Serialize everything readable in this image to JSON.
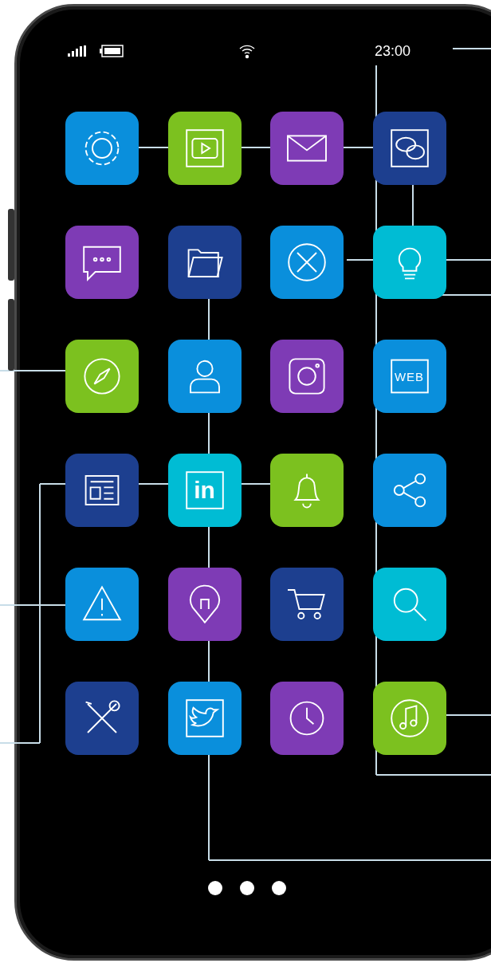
{
  "status_bar": {
    "time": "23:00"
  },
  "apps": [
    {
      "kind": "settings",
      "color": "#0a8fdc"
    },
    {
      "kind": "video",
      "color": "#7cc11f"
    },
    {
      "kind": "mail",
      "color": "#7e3bb5"
    },
    {
      "kind": "chat",
      "color": "#1d3f8f"
    },
    {
      "kind": "message",
      "color": "#7e3bb5"
    },
    {
      "kind": "folder",
      "color": "#1d3f8f"
    },
    {
      "kind": "repair",
      "color": "#0a8fdc"
    },
    {
      "kind": "bulb",
      "color": "#00bcd4"
    },
    {
      "kind": "compass",
      "color": "#7cc11f"
    },
    {
      "kind": "person",
      "color": "#0a8fdc"
    },
    {
      "kind": "camera",
      "color": "#7e3bb5"
    },
    {
      "kind": "web",
      "color": "#0a8fdc",
      "label": "WEB"
    },
    {
      "kind": "news",
      "color": "#1d3f8f"
    },
    {
      "kind": "linked",
      "color": "#00bcd4",
      "label": "in"
    },
    {
      "kind": "bell",
      "color": "#7cc11f"
    },
    {
      "kind": "share",
      "color": "#0a8fdc"
    },
    {
      "kind": "warning",
      "color": "#0a8fdc"
    },
    {
      "kind": "pin",
      "color": "#7e3bb5"
    },
    {
      "kind": "cart",
      "color": "#1d3f8f"
    },
    {
      "kind": "search",
      "color": "#00bcd4"
    },
    {
      "kind": "tools",
      "color": "#1d3f8f"
    },
    {
      "kind": "bird",
      "color": "#0a8fdc"
    },
    {
      "kind": "clock",
      "color": "#7e3bb5"
    },
    {
      "kind": "music",
      "color": "#7cc11f"
    }
  ]
}
